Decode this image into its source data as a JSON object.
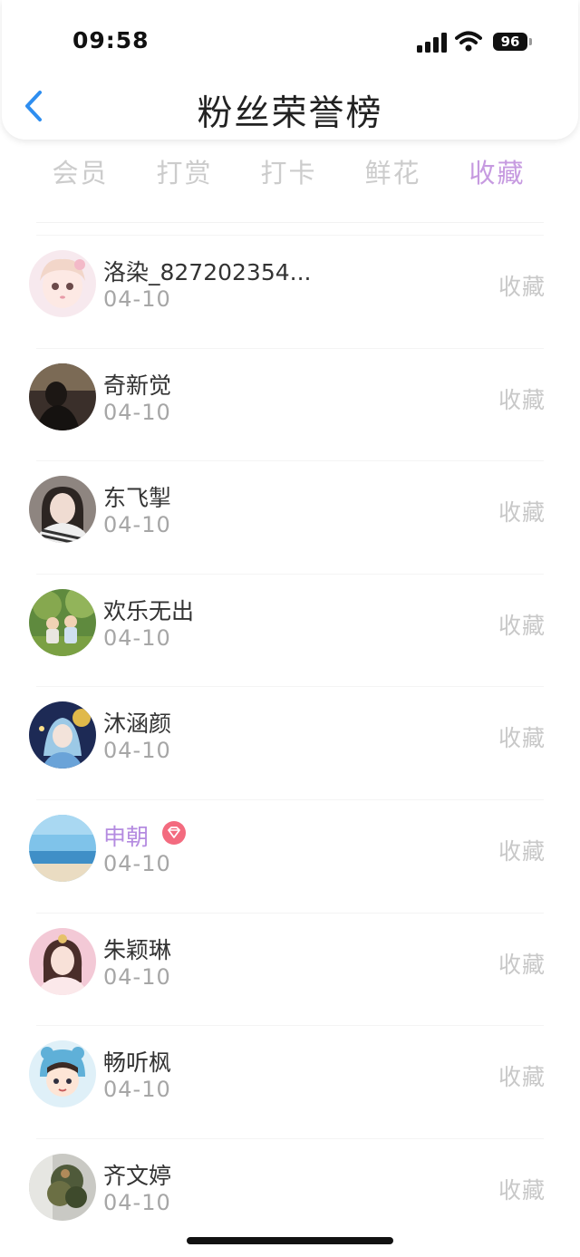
{
  "status_bar": {
    "time": "09:58",
    "battery": "96"
  },
  "header": {
    "title": "粉丝荣誉榜",
    "back_icon": "chevron-left-icon"
  },
  "tabs": [
    {
      "label": "会员",
      "active": false
    },
    {
      "label": "打赏",
      "active": false
    },
    {
      "label": "打卡",
      "active": false
    },
    {
      "label": "鲜花",
      "active": false
    },
    {
      "label": "收藏",
      "active": true
    }
  ],
  "colors": {
    "accent": "#c69ae0",
    "back": "#2e8ef0",
    "vip_name": "#b48be0",
    "muted": "#c8c8c8"
  },
  "fans": [
    {
      "name": "洛染_827202354...",
      "date": "04-10",
      "action": "收藏",
      "vip": false
    },
    {
      "name": "奇新觉",
      "date": "04-10",
      "action": "收藏",
      "vip": false
    },
    {
      "name": "东飞掣",
      "date": "04-10",
      "action": "收藏",
      "vip": false
    },
    {
      "name": "欢乐无出",
      "date": "04-10",
      "action": "收藏",
      "vip": false
    },
    {
      "name": "沐涵颜",
      "date": "04-10",
      "action": "收藏",
      "vip": false
    },
    {
      "name": "申朝",
      "date": "04-10",
      "action": "收藏",
      "vip": true,
      "badge_icon": "diamond-badge-icon"
    },
    {
      "name": "朱颖琳",
      "date": "04-10",
      "action": "收藏",
      "vip": false
    },
    {
      "name": "畅听枫",
      "date": "04-10",
      "action": "收藏",
      "vip": false
    },
    {
      "name": "齐文婷",
      "date": "04-10",
      "action": "收藏",
      "vip": false
    }
  ]
}
